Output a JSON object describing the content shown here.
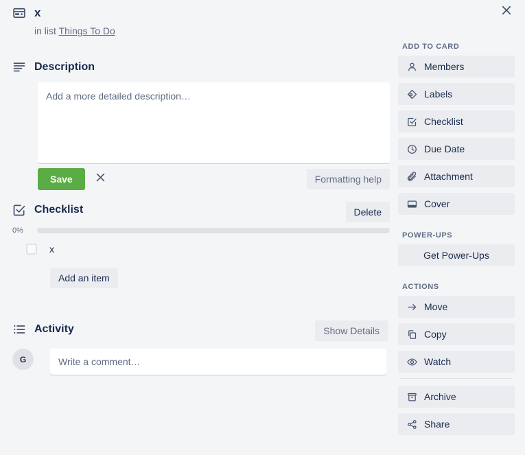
{
  "window": {
    "close_label": "×",
    "close_icon": "close-icon"
  },
  "card": {
    "icon": "card-icon",
    "title": "x",
    "list_prefix": "in list",
    "list_name": "Things To Do"
  },
  "description": {
    "icon": "description-lines-icon",
    "title": "Description",
    "placeholder": "Add a more detailed description…",
    "value": "",
    "save_label": "Save",
    "cancel_icon": "close-icon",
    "formatting_help_label": "Formatting help"
  },
  "checklist": {
    "icon": "checkbox-check-icon",
    "title": "Checklist",
    "delete_label": "Delete",
    "progress_percent": "0%",
    "progress_value": 0,
    "items": [
      {
        "label": "x",
        "checked": false
      }
    ],
    "add_item_label": "Add an item"
  },
  "activity": {
    "icon": "activity-list-icon",
    "title": "Activity",
    "show_details_label": "Show Details",
    "avatar_initials": "G",
    "comment_placeholder": "Write a comment…",
    "comment_value": ""
  },
  "sidebar": {
    "add_to_card": {
      "heading": "ADD TO CARD",
      "items": [
        {
          "label": "Members",
          "icon": "person-icon"
        },
        {
          "label": "Labels",
          "icon": "label-tag-icon"
        },
        {
          "label": "Checklist",
          "icon": "checkbox-check-icon"
        },
        {
          "label": "Due Date",
          "icon": "clock-icon"
        },
        {
          "label": "Attachment",
          "icon": "paperclip-icon"
        },
        {
          "label": "Cover",
          "icon": "cover-card-icon"
        }
      ]
    },
    "power_ups": {
      "heading": "POWER-UPS",
      "items": [
        {
          "label": "Get Power-Ups",
          "icon": "none"
        }
      ]
    },
    "actions": {
      "heading": "ACTIONS",
      "items": [
        {
          "label": "Move",
          "icon": "arrow-right-icon"
        },
        {
          "label": "Copy",
          "icon": "copy-icon"
        },
        {
          "label": "Watch",
          "icon": "eye-icon"
        }
      ],
      "items_secondary": [
        {
          "label": "Archive",
          "icon": "archive-icon"
        },
        {
          "label": "Share",
          "icon": "share-icon"
        }
      ]
    }
  },
  "colors": {
    "background": "#F4F5F7",
    "text": "#172B4D",
    "muted_text": "#5E6C84",
    "button_grey": "#EBECF0",
    "save_green": "#5AAC44",
    "progress_track": "#DFE1E6"
  }
}
